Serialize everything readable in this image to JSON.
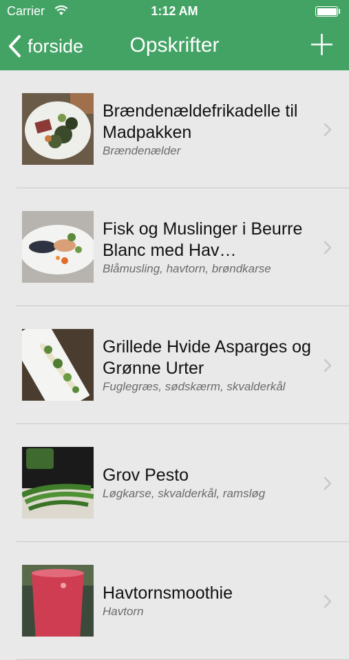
{
  "status_bar": {
    "carrier": "Carrier",
    "time": "1:12 AM"
  },
  "nav": {
    "back_label": "forside",
    "title": "Opskrifter",
    "add_icon": "plus-icon"
  },
  "colors": {
    "header": "#43a365",
    "background": "#e9e9e9",
    "separator": "#c8c8c8"
  },
  "recipes": [
    {
      "title": "Brændenældefrikadelle til Madpakken",
      "subtitle": "Brændenælder"
    },
    {
      "title": "Fisk og Muslinger i Beurre Blanc med Hav…",
      "subtitle": "Blåmusling, havtorn, brøndkarse"
    },
    {
      "title": "Grillede Hvide Asparges og Grønne Urter",
      "subtitle": "Fuglegræs, sødskærm, skvalderkål"
    },
    {
      "title": "Grov Pesto",
      "subtitle": "Løgkarse, skvalderkål, ramsløg"
    },
    {
      "title": "Havtornsmoothie",
      "subtitle": "Havtorn"
    }
  ]
}
